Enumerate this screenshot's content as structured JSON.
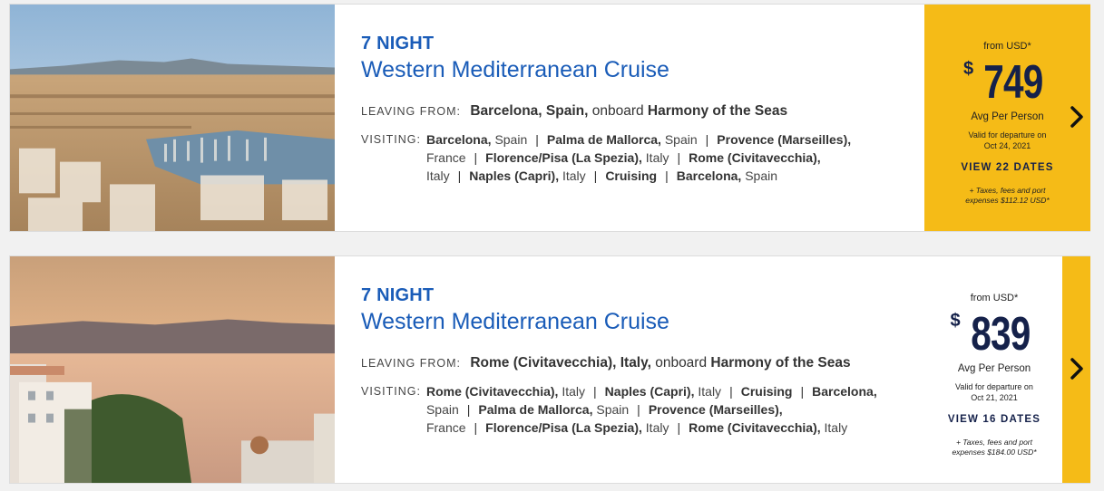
{
  "cruises": [
    {
      "nights": "7 NIGHT",
      "title": "Western Mediterranean Cruise",
      "leaving_label": "LEAVING FROM:",
      "leaving_port": "Barcelona, Spain,",
      "onboard_text": "onboard",
      "ship": "Harmony of the Seas",
      "visiting_label": "VISITING:",
      "ports": [
        {
          "city": "Barcelona,",
          "country": "Spain"
        },
        {
          "city": "Palma de Mallorca,",
          "country": "Spain"
        },
        {
          "city": "Provence (Marseilles),",
          "country": "France"
        },
        {
          "city": "Florence/Pisa (La Spezia),",
          "country": "Italy"
        },
        {
          "city": "Rome (Civitavecchia),",
          "country": "Italy"
        },
        {
          "city": "Naples (Capri),",
          "country": "Italy"
        },
        {
          "city": "Cruising",
          "country": ""
        },
        {
          "city": "Barcelona,",
          "country": "Spain"
        }
      ],
      "from_label": "from USD*",
      "currency_symbol": "$",
      "price": "749",
      "avg_label": "Avg Per Person",
      "valid_line1": "Valid for departure on",
      "valid_line2": "Oct 24, 2021",
      "view_dates": "VIEW 22 DATES",
      "taxes_line1": "+ Taxes, fees and port",
      "taxes_line2": "expenses $112.12 USD*"
    },
    {
      "nights": "7 NIGHT",
      "title": "Western Mediterranean Cruise",
      "leaving_label": "LEAVING FROM:",
      "leaving_port": "Rome (Civitavecchia), Italy,",
      "onboard_text": "onboard",
      "ship": "Harmony of the Seas",
      "visiting_label": "VISITING:",
      "ports": [
        {
          "city": "Rome (Civitavecchia),",
          "country": "Italy"
        },
        {
          "city": "Naples (Capri),",
          "country": "Italy"
        },
        {
          "city": "Cruising",
          "country": ""
        },
        {
          "city": "Barcelona,",
          "country": "Spain"
        },
        {
          "city": "Palma de Mallorca,",
          "country": "Spain"
        },
        {
          "city": "Provence (Marseilles),",
          "country": "France"
        },
        {
          "city": "Florence/Pisa (La Spezia),",
          "country": "Italy"
        },
        {
          "city": "Rome (Civitavecchia),",
          "country": "Italy"
        }
      ],
      "from_label": "from USD*",
      "currency_symbol": "$",
      "price": "839",
      "avg_label": "Avg Per Person",
      "valid_line1": "Valid for departure on",
      "valid_line2": "Oct 21, 2021",
      "view_dates": "VIEW 16 DATES",
      "taxes_line1": "+ Taxes, fees and port",
      "taxes_line2": "expenses $184.00 USD*"
    }
  ],
  "colors": {
    "accent_blue": "#1a5cb8",
    "price_yellow": "#f5bb17",
    "navy": "#15214a"
  },
  "icons": {
    "next": "chevron-right-icon"
  }
}
